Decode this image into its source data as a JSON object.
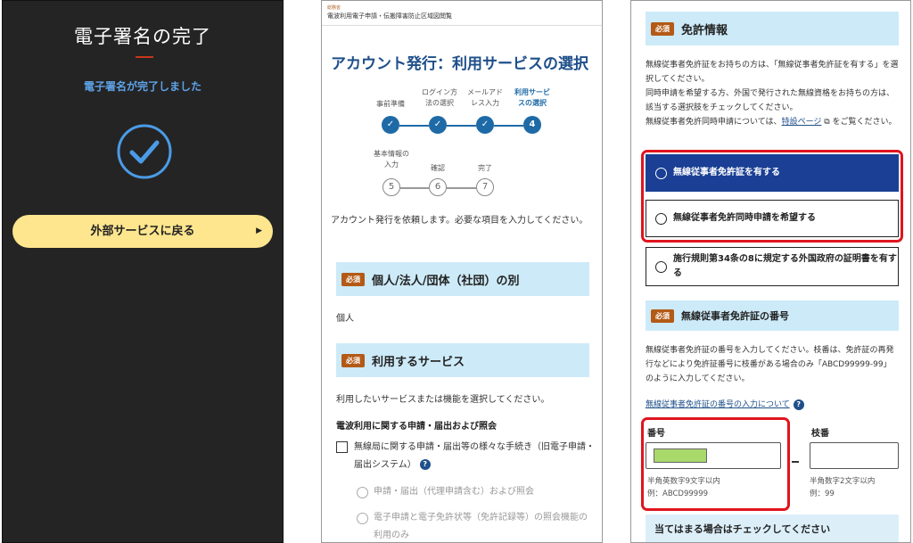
{
  "panel1": {
    "title": "電子署名の完了",
    "message": "電子署名が完了しました",
    "back_button": "外部サービスに戻る",
    "arrow": "▶"
  },
  "panel2": {
    "header_small": "総務省",
    "header_site": "電波利用電子申請・伝搬障害防止区域図閲覧",
    "title": "アカウント発行：利用サービスの選択",
    "steps": [
      {
        "label": "事前準備",
        "state": "done"
      },
      {
        "label": "ログイン方法の選択",
        "state": "done"
      },
      {
        "label": "メールアドレス入力",
        "state": "done"
      },
      {
        "label": "利用サービスの選択",
        "state": "current",
        "num": "4"
      },
      {
        "label": "基本情報の入力",
        "state": "todo",
        "num": "5"
      },
      {
        "label": "確認",
        "state": "todo",
        "num": "6"
      },
      {
        "label": "完了",
        "state": "todo",
        "num": "7"
      }
    ],
    "step_label_lines": {
      "s2a": "ログイン方",
      "s2b": "法の選択",
      "s3a": "メールアド",
      "s3b": "レス入力",
      "s4a": "利用サービ",
      "s4b": "スの選択",
      "s5a": "基本情報の",
      "s5b": "入力"
    },
    "intro": "アカウント発行を依頼します。必要な項目を入力してください。",
    "required_badge": "必須",
    "section1_title": "個人/法人/団体（社団）の別",
    "section1_value": "個人",
    "section2_title": "利用するサービス",
    "section2_note": "利用したいサービスまたは機能を選択してください。",
    "subheading": "電波利用に関する申請・届出および照会",
    "checkbox_label": "無線局に関する申請・届出等の様々な手続き（旧電子申請・届出システム）",
    "radio1": "申請・届出（代理申請含む）および照会",
    "radio2": "電子申請と電子免許状等（免許記録等）の照会機能の利用のみ"
  },
  "panel3": {
    "required_badge": "必須",
    "license_title": "免許情報",
    "license_desc_1": "無線従事者免許証をお持ちの方は、「無線従事者免許証を有する」を選択してください。",
    "license_desc_2": "同時申請を希望する方、外国で発行された無線資格をお持ちの方は、該当する選択肢をチェックしてください。",
    "license_desc_3a": "無線従事者免許同時申請については、",
    "license_link": "特設ページ",
    "license_desc_3b": "をご覧ください。",
    "option1": "無線従事者免許証を有する",
    "option2": "無線従事者免許同時申請を希望する",
    "option3": "施行規則第34条の8に規定する外国政府の証明書を有する",
    "number_title": "無線従事者免許証の番号",
    "number_desc": "無線従事者免許証の番号を入力してください。枝番は、免許証の再発行などにより免許証番号に枝番がある場合のみ「ABCD99999-99」のように入力してください。",
    "number_link": "無線従事者免許証の番号の入力について",
    "field_number_label": "番号",
    "field_branch_label": "枝番",
    "field_number_hint1": "半角英数字9文字以内",
    "field_number_hint2": "例：ABCD99999",
    "field_branch_hint1": "半角数字2文字以内",
    "field_branch_hint2": "例：99",
    "bottom_heading": "当てはまる場合はチェックしてください"
  },
  "colors": {
    "accent_blue": "#1a3f94",
    "highlight_red": "#e0141e",
    "button_yellow": "#fde68e",
    "redacted_green": "#a9d86b"
  }
}
